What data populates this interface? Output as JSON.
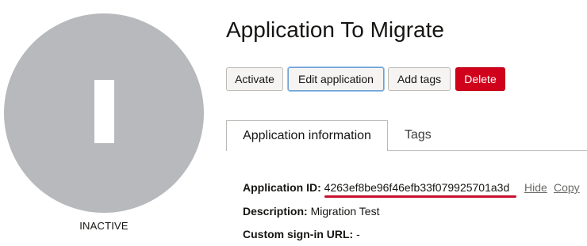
{
  "avatar": {
    "initial": "I",
    "status": "INACTIVE"
  },
  "header": {
    "title": "Application To Migrate"
  },
  "actions": {
    "activate": "Activate",
    "edit": "Edit application",
    "add_tags": "Add tags",
    "delete": "Delete"
  },
  "tabs": {
    "info": "Application information",
    "tags": "Tags"
  },
  "details": {
    "app_id_label": "Application ID:",
    "app_id_value": "4263ef8be96f46efb33f079925701a3d",
    "hide": "Hide",
    "copy": "Copy",
    "description_label": "Description:",
    "description_value": "Migration Test",
    "signin_label": "Custom sign-in URL:",
    "signin_value": "-"
  },
  "colors": {
    "avatar_bg": "#b8b9bd",
    "delete_bg": "#d0021b",
    "underline": "#c8102e"
  }
}
